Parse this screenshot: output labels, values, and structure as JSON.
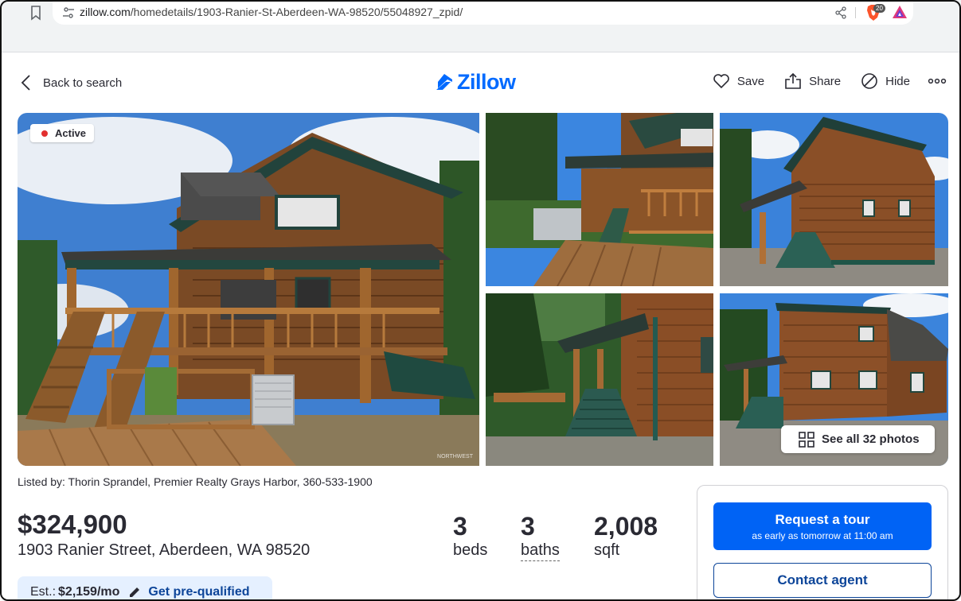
{
  "browser": {
    "url_host": "zillow.com",
    "url_path": "/homedetails/1903-Ranier-St-Aberdeen-WA-98520/55048927_zpid/",
    "shield_count": "20"
  },
  "header": {
    "back_label": "Back to search",
    "logo_text": "Zillow",
    "save_label": "Save",
    "share_label": "Share",
    "hide_label": "Hide",
    "brand_color": "#006aff"
  },
  "gallery": {
    "status_badge": "Active",
    "see_all_label": "See all 32 photos",
    "watermark": "NORTHWEST"
  },
  "listing": {
    "listed_by": "Listed by: Thorin Sprandel, Premier Realty Grays Harbor, 360-533-1900",
    "price": "$324,900",
    "address": "1903 Ranier Street, Aberdeen, WA 98520",
    "beds": {
      "value": "3",
      "label": "beds"
    },
    "baths": {
      "value": "3",
      "label": "baths"
    },
    "sqft": {
      "value": "2,008",
      "label": "sqft"
    },
    "est_label": "Est.:",
    "est_value": "$2,159/mo",
    "prequal_label": "Get pre-qualified"
  },
  "contact": {
    "tour_label": "Request a tour",
    "tour_sub": "as early as tomorrow at 11:00 am",
    "agent_label": "Contact agent",
    "primary_color": "#0063f5"
  }
}
